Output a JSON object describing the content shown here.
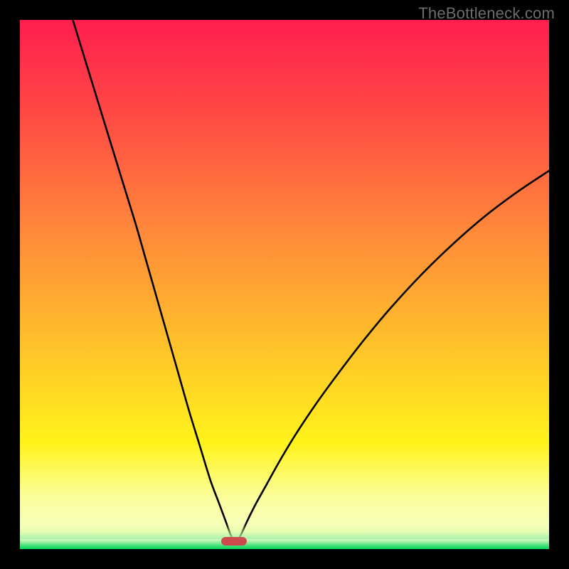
{
  "watermark": "TheBottleneck.com",
  "chart_data": {
    "type": "line",
    "title": "",
    "xlabel": "",
    "ylabel": "",
    "xlim": [
      0,
      100
    ],
    "ylim": [
      0,
      100
    ],
    "legend_position": "none",
    "grid": false,
    "background_gradient": {
      "stops": [
        {
          "offset": 0.0,
          "color": "#ff1e4f"
        },
        {
          "offset": 0.18,
          "color": "#ff4a44"
        },
        {
          "offset": 0.4,
          "color": "#ff893a"
        },
        {
          "offset": 0.62,
          "color": "#ffc32a"
        },
        {
          "offset": 0.8,
          "color": "#fff31a"
        },
        {
          "offset": 0.9,
          "color": "#fbfe9a"
        },
        {
          "offset": 1.0,
          "color": "#f3ffd3"
        }
      ]
    },
    "bottom_band": {
      "present": true,
      "colors": [
        "#00d65a",
        "#9ef0a0"
      ]
    },
    "marker": {
      "x": 40.5,
      "y": 1.5,
      "shape": "rounded-rect",
      "color": "#cc4a4d"
    },
    "series": [
      {
        "name": "left-curve",
        "color": "#000000",
        "x": [
          10.0,
          12.0,
          14.0,
          16.0,
          18.0,
          20.0,
          22.0,
          24.0,
          26.0,
          28.0,
          30.0,
          32.0,
          34.0,
          36.0,
          37.5,
          38.8,
          39.7,
          40.3
        ],
        "y": [
          100.0,
          93.5,
          87.0,
          80.5,
          74.0,
          67.5,
          61.0,
          54.0,
          47.0,
          40.0,
          33.0,
          26.0,
          19.5,
          13.0,
          9.0,
          5.5,
          3.0,
          1.6
        ]
      },
      {
        "name": "right-curve",
        "color": "#000000",
        "x": [
          41.2,
          42.0,
          43.0,
          44.5,
          46.5,
          49.0,
          52.0,
          56.0,
          60.0,
          65.0,
          70.0,
          76.0,
          82.0,
          88.0,
          94.0,
          100.0
        ],
        "y": [
          1.6,
          3.2,
          5.4,
          8.4,
          12.0,
          16.5,
          21.5,
          27.5,
          33.0,
          39.5,
          45.5,
          52.0,
          57.8,
          63.0,
          67.5,
          71.5
        ]
      }
    ]
  }
}
